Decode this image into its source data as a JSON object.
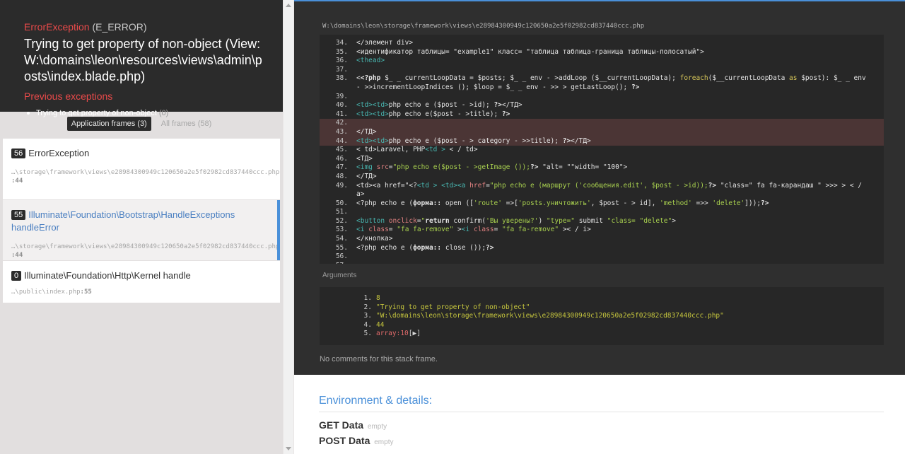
{
  "exception": {
    "class": "ErrorException",
    "code": "(E_ERROR)",
    "message": "Trying to get property of non-object (View: W:\\domains\\leon\\resources\\views\\admin\\posts\\index.blade.php)",
    "previous_title": "Previous exceptions",
    "previous": [
      {
        "text": "Trying to get property of non-object",
        "count": "(0)"
      }
    ]
  },
  "frames_toggle": {
    "application": "Application frames (3)",
    "all": "All frames (58)"
  },
  "frames": [
    {
      "num": "56",
      "class": "ErrorException",
      "path": "…\\storage\\framework\\views\\e28984300949c120650a2e5f02982cd837440ccc.php",
      "line": ":44"
    },
    {
      "num": "55",
      "class": "Illuminate\\Foundation\\Bootstrap\\HandleExceptions handleError",
      "path": "…\\storage\\framework\\views\\e28984300949c120650a2e5f02982cd837440ccc.php",
      "line": ":44"
    },
    {
      "num": "0",
      "class": "Illuminate\\Foundation\\Http\\Kernel handle",
      "path": "…\\public\\index.php",
      "line": ":55"
    }
  ],
  "file_path": "W:\\domains\\leon\\storage\\framework\\views\\e28984300949c120650a2e5f02982cd837440ccc.php",
  "code_lines": [
    {
      "n": "34.",
      "html": "&lt;/элемент div&gt;"
    },
    {
      "n": "35.",
      "html": "&lt;идентификатор таблицы= \"example1\" класс= \"таблица таблица-граница таблицы-полосатый\"&gt;"
    },
    {
      "n": "36.",
      "html": "<span class=\"tg\">&lt;thead&gt;</span>"
    },
    {
      "n": "37.",
      "html": ""
    },
    {
      "n": "38.",
      "html": "&lt;<span class=\"bd\">&lt;?php</span> $_ _ currentLoopData = $posts; $_ _ env - &gt;addLoop ($__currentLoopData); <span class=\"kw\">foreach</span>($__currentLoopData <span class=\"kw\">as</span> $post): $_ _ env"
    },
    {
      "n": "",
      "html": "- &gt;&gt;incrementLoopIndices (); $loop = $_ _ env - &gt;&gt; &gt; getLastLoop(); <span class=\"bd\">?&gt;</span>"
    },
    {
      "n": "39.",
      "html": ""
    },
    {
      "n": "40.",
      "html": "<span class=\"tg\">&lt;td&gt;&lt;td&gt;</span>php echo e ($post - &gt;id); <span class=\"bd\">?&gt;</span>&lt;/TД&gt;"
    },
    {
      "n": "41.",
      "html": "<span class=\"tg\">&lt;td&gt;&lt;td&gt;</span>php echo e($post - &gt;title); <span class=\"bd\">?&gt;</span>"
    },
    {
      "n": "42.",
      "html": "",
      "hl": true
    },
    {
      "n": "43.",
      "html": "&lt;/TД&gt;",
      "hl": true
    },
    {
      "n": "44.",
      "html": "<span class=\"tg\">&lt;td&gt;&lt;td&gt;</span>php echo e ($post - &gt; category - &gt;&gt;title); <span class=\"bd\">?&gt;</span>&lt;/TД&gt;",
      "hl": true
    },
    {
      "n": "45.",
      "html": "&lt; td&gt;Laravel, PHP<span class=\"tg\">&lt;td &gt;</span> &lt; / td&gt;"
    },
    {
      "n": "46.",
      "html": "&lt;TД&gt;"
    },
    {
      "n": "47.",
      "html": "<span class=\"tg\">&lt;img</span> <span class=\"at\">src</span>=<span class=\"st\">\"php echo e($post - &gt;getImage ());</span><span class=\"bd\">?&gt;</span> \"alt= \"\"width= \"100\"&gt;"
    },
    {
      "n": "48.",
      "html": "&lt;/TД&gt;"
    },
    {
      "n": "49.",
      "html": "&lt;td&gt;&lt;a href=\"&lt;?<span class=\"tg\">&lt;td &gt; &lt;td&gt;&lt;a</span> <span class=\"at\">href</span>=<span class=\"st\">\"php echo e (маршрут ('сообщения.edit', $post - &gt;id));</span><span class=\"bd\">?&gt;</span> \"class=\" fa fa-карандаш \" &gt;&gt;&gt; &gt; &lt; /"
    },
    {
      "n": "",
      "html": "a&gt;"
    },
    {
      "n": "50.",
      "html": "&lt;?php echo e (<span class=\"bd\">форма::</span> open ([<span class=\"st\">'route'</span> =&gt;[<span class=\"st\">'posts.уничтожить'</span>, $post - &gt; id], <span class=\"st\">'method'</span> =&gt;&gt; <span class=\"st\">'delete'</span>]));<span class=\"bd\">?&gt;</span>"
    },
    {
      "n": "51.",
      "html": ""
    },
    {
      "n": "52.",
      "html": "<span class=\"tg\">&lt;button</span> <span class=\"at\">onclick</span>=<span class=\"st\">\"</span><span class=\"bd\">return</span> confirm(<span class=\"st\">'Вы уверены?'</span>) <span class=\"st\">\"type=\"</span> submit <span class=\"st\">\"class= \"delete\"</span>&gt;"
    },
    {
      "n": "53.",
      "html": "<span class=\"tg\">&lt;i</span> <span class=\"at\">class</span>= <span class=\"st\">\"fa fa-remove\"</span> &gt;<span class=\"tg\">&lt;i</span> <span class=\"at\">class</span>= <span class=\"st\">\"fa fa-remove\"</span> &gt;&lt; / i&gt;"
    },
    {
      "n": "54.",
      "html": "&lt;/кнопка&gt;"
    },
    {
      "n": "55.",
      "html": "&lt;?php echo e (<span class=\"bd\">форма::</span> close ());<span class=\"bd\">?&gt;</span>"
    },
    {
      "n": "56.",
      "html": ""
    },
    {
      "n": "57.",
      "html": ""
    }
  ],
  "arguments_label": "Arguments",
  "arguments": [
    {
      "n": "1.",
      "v": "8",
      "cls": ""
    },
    {
      "n": "2.",
      "v": "\"Trying to get property of non-object\"",
      "cls": ""
    },
    {
      "n": "3.",
      "v": "\"W:\\domains\\leon\\storage\\framework\\views\\e28984300949c120650a2e5f02982cd837440ccc.php\"",
      "cls": ""
    },
    {
      "n": "4.",
      "v": "44",
      "cls": ""
    },
    {
      "n": "5.",
      "v": "array:10",
      "extra": " [▶]",
      "cls": "av-red"
    }
  ],
  "no_comments": "No comments for this stack frame.",
  "env": {
    "title": "Environment & details:",
    "rows": [
      {
        "label": "GET Data",
        "state": "empty"
      },
      {
        "label": "POST Data",
        "state": "empty"
      }
    ]
  },
  "colors": {
    "accent": "#4a90d9",
    "error": "#e94a4a",
    "dark_bg": "#2b2b2b"
  }
}
